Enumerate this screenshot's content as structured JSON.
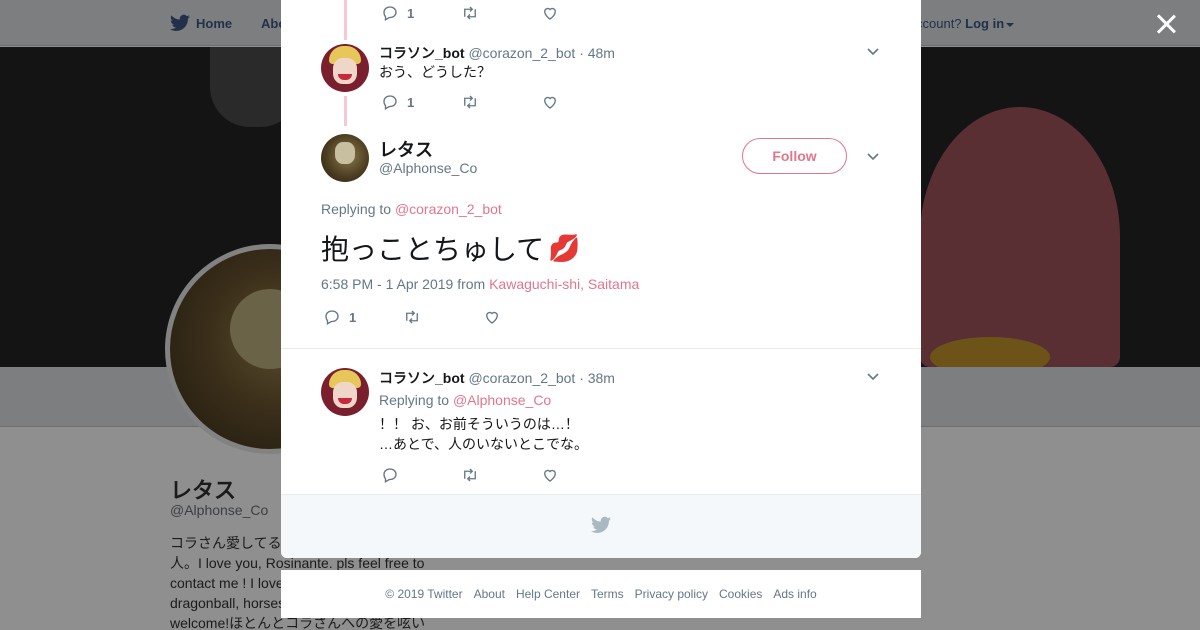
{
  "nav": {
    "home": "Home",
    "about": "Abo",
    "account_prompt": "ccount?",
    "login": "Log in"
  },
  "profile": {
    "name": "レタス",
    "handle": "@Alphonse_Co",
    "bio_lines": [
      "コラさん愛してる",
      "人。I love you, Rosinante. pls feel free to",
      "contact me ! I love",
      "dragonball, horses",
      "welcome!ほとんとコラさんへの愛を呟い"
    ]
  },
  "thread": {
    "top_actions": {
      "reply_count": "1"
    },
    "tweet1": {
      "name": "コラソン_bot",
      "handle": "@corazon_2_bot",
      "time": "· 48m",
      "text": "おう、どうした？",
      "reply_count": "1"
    },
    "main": {
      "name": "レタス",
      "handle": "@Alphonse_Co",
      "follow": "Follow",
      "replying_label": "Replying to",
      "replying_to": "@corazon_2_bot",
      "text": "抱っことちゅして",
      "emoji": "💋",
      "timestamp": "6:58 PM - 1 Apr 2019 from",
      "location": "Kawaguchi-shi, Saitama",
      "reply_count": "1"
    },
    "tweet2": {
      "name": "コラソン_bot",
      "handle": "@corazon_2_bot",
      "time": "· 38m",
      "replying_label": "Replying to",
      "replying_to": "@Alphonse_Co",
      "line1": "！！ お、お前そういうのは…！",
      "line2": "…あとで、人のいないとこでな。"
    }
  },
  "footer": {
    "copyright": "© 2019 Twitter",
    "about": "About",
    "help": "Help Center",
    "terms": "Terms",
    "privacy": "Privacy policy",
    "cookies": "Cookies",
    "ads": "Ads info"
  },
  "colors": {
    "accent": "#e2768d",
    "muted": "#657786",
    "thread_line": "#f7c8d2"
  },
  "icons": [
    "twitter-bird-icon",
    "reply-icon",
    "retweet-icon",
    "like-icon",
    "chevron-down-icon",
    "close-icon",
    "kiss-emoji"
  ]
}
